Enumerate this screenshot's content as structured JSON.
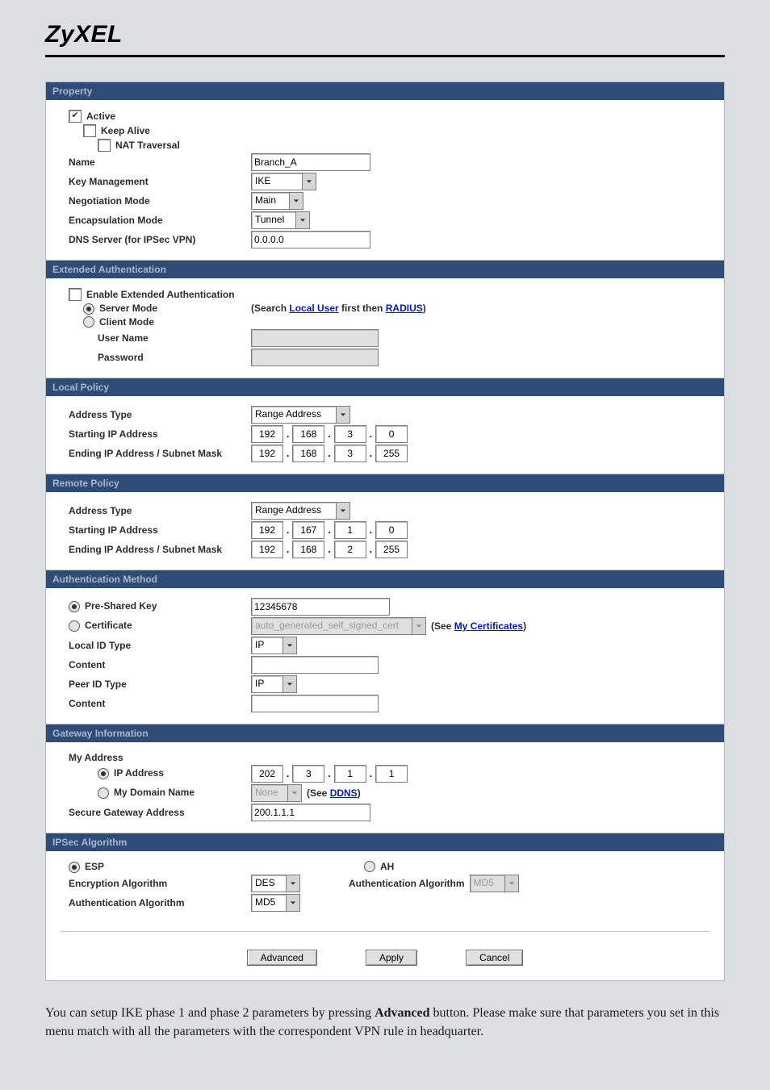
{
  "brand": "ZyXEL",
  "sections": {
    "property": "Property",
    "extauth": "Extended Authentication",
    "localpolicy": "Local Policy",
    "remotepolicy": "Remote Policy",
    "authmethod": "Authentication Method",
    "gateway": "Gateway Information",
    "ipsecalg": "IPSec Algorithm"
  },
  "property": {
    "active_label": "Active",
    "keepalive_label": "Keep Alive",
    "nattrav_label": "NAT Traversal",
    "name_label": "Name",
    "name_value": "Branch_A",
    "keymgmt_label": "Key Management",
    "keymgmt_value": "IKE",
    "negmode_label": "Negotiation Mode",
    "negmode_value": "Main",
    "encap_label": "Encapsulation Mode",
    "encap_value": "Tunnel",
    "dns_label": "DNS Server (for IPSec VPN)",
    "dns_value": "0.0.0.0"
  },
  "extauth": {
    "enable_label": "Enable Extended Authentication",
    "server_label": "Server Mode",
    "client_label": "Client Mode",
    "hint_prefix": "(Search ",
    "hint_link1": "Local User",
    "hint_mid": " first then ",
    "hint_link2": "RADIUS",
    "hint_suffix": ")",
    "user_label": "User Name",
    "pass_label": "Password"
  },
  "localpolicy": {
    "addrtype_label": "Address Type",
    "addrtype_value": "Range Address",
    "start_label": "Starting IP Address",
    "start_ip": [
      "192",
      "168",
      "3",
      "0"
    ],
    "end_label": "Ending IP Address / Subnet Mask",
    "end_ip": [
      "192",
      "168",
      "3",
      "255"
    ]
  },
  "remotepolicy": {
    "addrtype_label": "Address Type",
    "addrtype_value": "Range Address",
    "start_label": "Starting IP Address",
    "start_ip": [
      "192",
      "167",
      "1",
      "0"
    ],
    "end_label": "Ending IP Address / Subnet Mask",
    "end_ip": [
      "192",
      "168",
      "2",
      "255"
    ]
  },
  "authmethod": {
    "psk_label": "Pre-Shared Key",
    "psk_value": "12345678",
    "cert_label": "Certificate",
    "cert_value": "auto_generated_self_signed_cert",
    "cert_hint_prefix": "(See ",
    "cert_hint_link": "My Certificates",
    "cert_hint_suffix": ")",
    "localid_label": "Local ID Type",
    "localid_value": "IP",
    "content1_label": "Content",
    "peerid_label": "Peer ID Type",
    "peerid_value": "IP",
    "content2_label": "Content"
  },
  "gateway": {
    "myaddr_label": "My Address",
    "ipaddr_label": "IP Address",
    "ip": [
      "202",
      "3",
      "1",
      "1"
    ],
    "mydom_label": "My Domain Name",
    "mydom_value": "None",
    "mydom_hint_prefix": "(See ",
    "mydom_hint_link": "DDNS",
    "mydom_hint_suffix": ")",
    "secgw_label": "Secure Gateway Address",
    "secgw_value": "200.1.1.1"
  },
  "ipsecalg": {
    "esp_label": "ESP",
    "ah_label": "AH",
    "encalg_label": "Encryption Algorithm",
    "encalg_value": "DES",
    "authalg_label": "Authentication Algorithm",
    "authalg_value": "MD5",
    "ah_authalg_label": "Authentication Algorithm",
    "ah_authalg_value": "MD5"
  },
  "buttons": {
    "advanced": "Advanced",
    "apply": "Apply",
    "cancel": "Cancel"
  },
  "footnote": {
    "a": "You can setup IKE phase 1 and phase 2 parameters by pressing ",
    "b": "Advanced",
    "c": " button. Please make sure that parameters you set in this menu match with all the parameters with the correspondent VPN rule in headquarter."
  }
}
